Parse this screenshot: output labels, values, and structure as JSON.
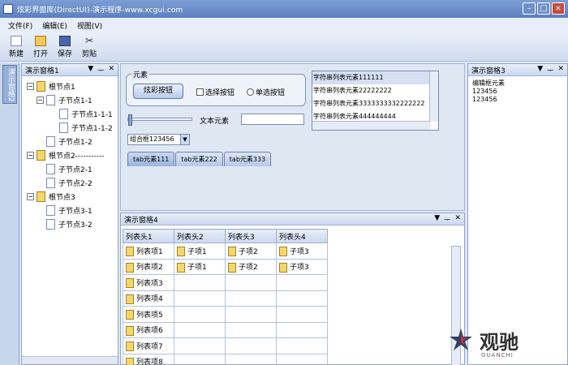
{
  "window": {
    "title": "炫彩界面库(DirectUI)-演示程序-www.xcgui.com"
  },
  "menu": [
    {
      "label": "文件(F)"
    },
    {
      "label": "编辑(E)"
    },
    {
      "label": "视图(V)"
    }
  ],
  "toolbar": [
    {
      "label": "新建",
      "icon": "new-file-icon"
    },
    {
      "label": "打开",
      "icon": "open-folder-icon"
    },
    {
      "label": "保存",
      "icon": "save-icon"
    },
    {
      "label": "剪贴",
      "icon": "cut-icon"
    }
  ],
  "left_tab": {
    "label": "演示窗格2"
  },
  "pane1": {
    "title": "演示窗格1",
    "tree": [
      {
        "label": "根节点1",
        "level": 0,
        "toggle": "−",
        "icon": "book"
      },
      {
        "label": "子节点1-1",
        "level": 1,
        "toggle": "−",
        "icon": "page"
      },
      {
        "label": "子节点1-1-1",
        "level": 2,
        "toggle": "",
        "icon": "page"
      },
      {
        "label": "子节点1-1-2",
        "level": 2,
        "toggle": "",
        "icon": "page"
      },
      {
        "label": "子节点1-2",
        "level": 1,
        "toggle": "",
        "icon": "page"
      },
      {
        "label": "根节点2-----------",
        "level": 0,
        "toggle": "−",
        "icon": "book"
      },
      {
        "label": "子节点2-1",
        "level": 1,
        "toggle": "",
        "icon": "page"
      },
      {
        "label": "子节点2-2",
        "level": 1,
        "toggle": "",
        "icon": "page"
      },
      {
        "label": "根节点3",
        "level": 0,
        "toggle": "−",
        "icon": "book"
      },
      {
        "label": "子节点3-1",
        "level": 1,
        "toggle": "",
        "icon": "page"
      },
      {
        "label": "子节点3-2",
        "level": 1,
        "toggle": "",
        "icon": "page"
      }
    ]
  },
  "center": {
    "group_title": "元素",
    "fancy_button": "炫彩按钮",
    "checkbox_label": "选择按钮",
    "radio_label": "单选按钮",
    "text_label": "文本元素",
    "combo_value": "组合框123456",
    "tabs": [
      "tab元素111",
      "tab元素222",
      "tab元素333"
    ],
    "list_items": [
      "字符串列表元素111111",
      "字符串列表元素22222222",
      "字符串列表元素3333333332222222",
      "字符串列表元素444444444"
    ]
  },
  "pane4": {
    "title": "演示窗格4",
    "columns": [
      "列表头1",
      "列表头2",
      "列表头3",
      "列表头4"
    ],
    "rows": [
      [
        "列表项1",
        "子项1",
        "子项2",
        "子项3"
      ],
      [
        "列表项2",
        "子项1",
        "子项2",
        "子项3"
      ],
      [
        "列表项3",
        "",
        "",
        ""
      ],
      [
        "列表项4",
        "",
        "",
        ""
      ],
      [
        "列表项5",
        "",
        "",
        ""
      ],
      [
        "列表项6",
        "",
        "",
        ""
      ],
      [
        "列表项7",
        "",
        "",
        ""
      ],
      [
        "列表项8",
        "",
        "",
        ""
      ]
    ]
  },
  "pane3": {
    "title": "演示窗格3",
    "lines": [
      "编辑框元素",
      "123456",
      "123456"
    ]
  },
  "pane_tools": [
    "▼",
    "ᅮ",
    "✕"
  ],
  "watermark": {
    "text": "观驰",
    "sub": "GUANCHI"
  }
}
